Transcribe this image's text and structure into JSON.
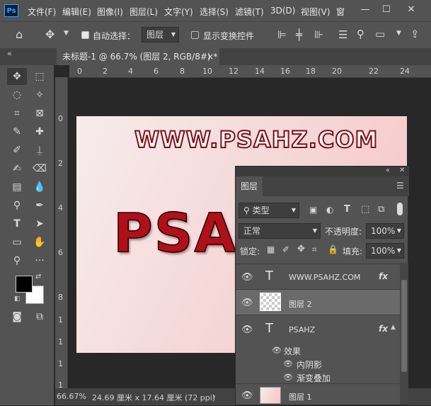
{
  "app": {
    "logo": "Ps"
  },
  "menu": [
    "文件(F)",
    "编辑(E)",
    "图像(I)",
    "图层(L)",
    "文字(Y)",
    "选择(S)",
    "滤镜(T)",
    "3D(D)",
    "视图(V)",
    "窗"
  ],
  "window_buttons": {
    "minimize": "—",
    "maximize": "☐",
    "close": "✕"
  },
  "options": {
    "auto_select_label": "自动选择：",
    "auto_select_value": "图层",
    "show_transform_label": "显示变换控件"
  },
  "tab": {
    "title": "未标题-1 @ 66.7% (图层 2, RGB/8#) *",
    "close": "×"
  },
  "panel_collapse": "«",
  "ruler_top": [
    "0",
    "2",
    "4",
    "6",
    "8",
    "10",
    "12",
    "14",
    "16",
    "18",
    "20",
    "22",
    "24"
  ],
  "ruler_left": [
    "0",
    "2",
    "4",
    "6",
    "8",
    "1",
    "1",
    "1",
    "1"
  ],
  "canvas": {
    "url_text": "WWW.PSAHZ.COM",
    "big_text": "PSAHZ"
  },
  "status": {
    "zoom": "66.67%",
    "size": "24.69 厘米 x 17.64 厘米 (72 ppi)",
    "arrow": "›"
  },
  "layers_panel": {
    "title": "图层",
    "filter_kind": "类型",
    "blend_mode": "正常",
    "opacity_label": "不透明度:",
    "opacity_value": "100%",
    "lock_label": "锁定:",
    "fill_label": "填充:",
    "fill_value": "100%",
    "layers": [
      {
        "name": "WWW.PSAHZ.COM",
        "type": "text",
        "fx": "fx"
      },
      {
        "name": "图层 2",
        "type": "pixel",
        "selected": true
      },
      {
        "name": "PSAHZ",
        "type": "text",
        "fx": "fx"
      },
      {
        "name": "图层 1",
        "type": "pixel"
      }
    ],
    "effects_label": "效果",
    "effects": [
      "内阴影",
      "渐变叠加"
    ]
  },
  "colors": {
    "foreground": "#000000",
    "background": "#ffffff",
    "accent": "#31a8ff"
  }
}
